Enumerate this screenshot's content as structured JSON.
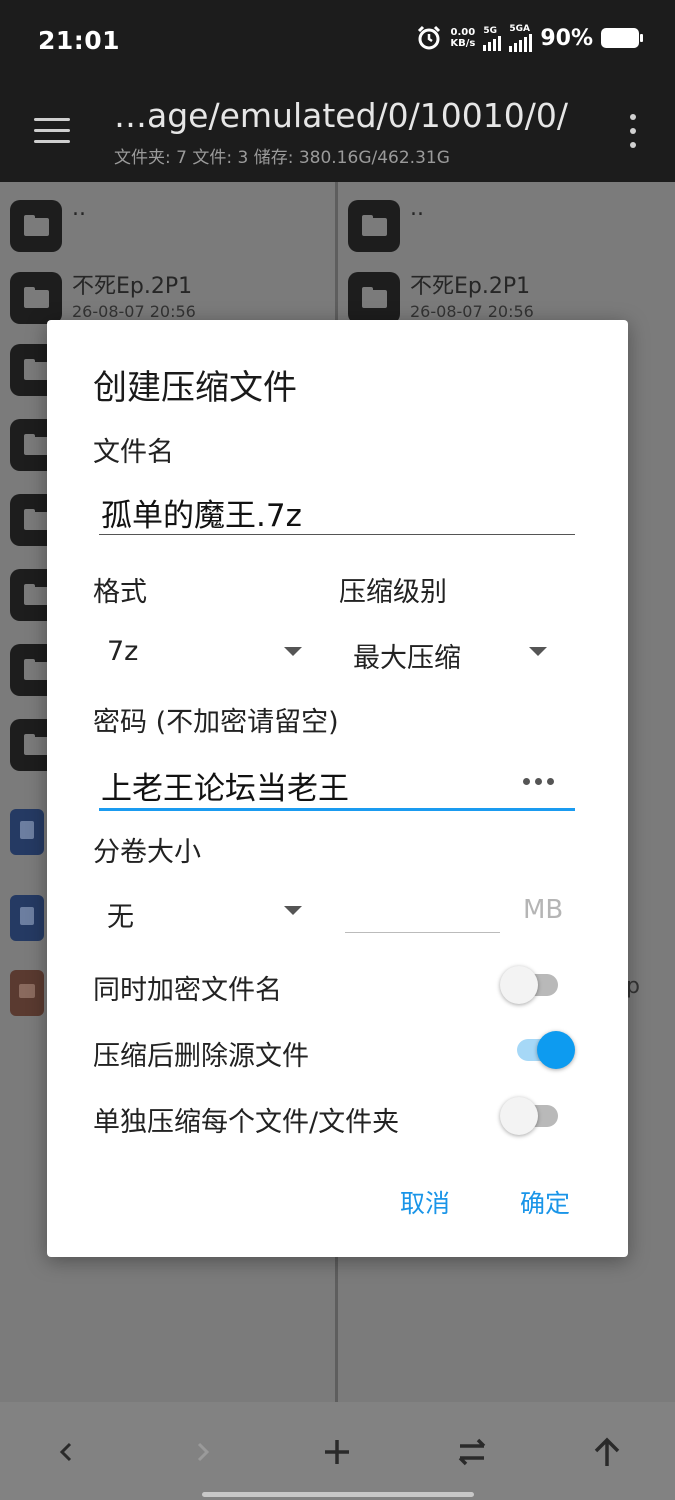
{
  "status_bar": {
    "time": "21:01",
    "net_speed": "0.00",
    "net_unit": "KB/s",
    "sim1_label": "5G",
    "sim2_label": "5GA",
    "battery": "90%"
  },
  "toolbar": {
    "path": "…age/emulated/0/10010/0/",
    "stats": "文件夹: 7  文件: 3  储存: 380.16G/462.31G"
  },
  "left_pane": {
    "rows": [
      {
        "name": "..",
        "date": ""
      },
      {
        "name": "不死Ep.2P1",
        "date": "26-08-07 20:56"
      }
    ]
  },
  "right_pane": {
    "rows": [
      {
        "name": "..",
        "date": ""
      },
      {
        "name": "不死Ep.2P1",
        "date": "26-08-07 20:56"
      }
    ],
    "partial_text": "p"
  },
  "dialog": {
    "title": "创建压缩文件",
    "filename_label": "文件名",
    "filename_value": "孤单的魔王.7z",
    "format_label": "格式",
    "format_value": "7z",
    "level_label": "压缩级别",
    "level_value": "最大压缩",
    "password_label": "密码 (不加密请留空)",
    "password_value": "上老王论坛当老王",
    "split_label": "分卷大小",
    "split_value": "无",
    "split_unit": "MB",
    "encrypt_names_label": "同时加密文件名",
    "encrypt_names_on": false,
    "delete_source_label": "压缩后删除源文件",
    "delete_source_on": true,
    "separate_label": "单独压缩每个文件/文件夹",
    "separate_on": false,
    "cancel_label": "取消",
    "ok_label": "确定"
  },
  "colors": {
    "accent": "#1a9bf0",
    "dialog_bg": "#ffffff",
    "toolbar_bg": "#1c1c1c"
  }
}
